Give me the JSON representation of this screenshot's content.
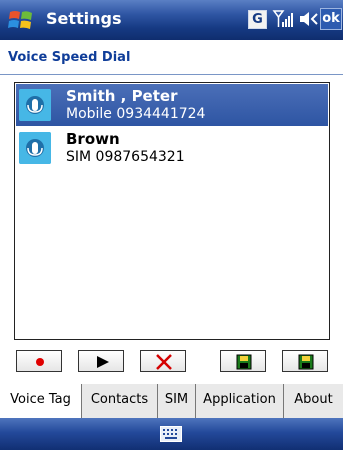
{
  "titlebar": {
    "app_title": "Settings",
    "g_indicator": "G",
    "ok_label": "ok",
    "icons": [
      "windows-start-icon",
      "signal-icon",
      "speaker-icon"
    ]
  },
  "page": {
    "title": "Voice Speed Dial"
  },
  "list": {
    "items": [
      {
        "name": "Smith , Peter",
        "detail": "Mobile 0934441724",
        "selected": true,
        "icon": "voice-tag-icon"
      },
      {
        "name": "Brown",
        "detail": "SIM 0987654321",
        "selected": false,
        "icon": "voice-tag-icon"
      }
    ]
  },
  "toolbar": {
    "buttons": [
      "record-icon",
      "play-icon",
      "delete-icon",
      "save-icon",
      "save-alt-icon"
    ]
  },
  "tabs": {
    "items": [
      {
        "label": "Voice Tag",
        "active": true
      },
      {
        "label": "Contacts",
        "active": false
      },
      {
        "label": "SIM",
        "active": false
      },
      {
        "label": "Application",
        "active": false
      },
      {
        "label": "About",
        "active": false
      }
    ]
  },
  "menubar": {
    "icons": [
      "keyboard-icon"
    ]
  },
  "colors": {
    "title_bar": "#163a83",
    "page_title": "#0f3d99",
    "selection": "#3a5fae",
    "voice_icon": "#46b7e6",
    "record": "#e00000",
    "delete": "#d40000",
    "save": "#1a7a1a"
  }
}
